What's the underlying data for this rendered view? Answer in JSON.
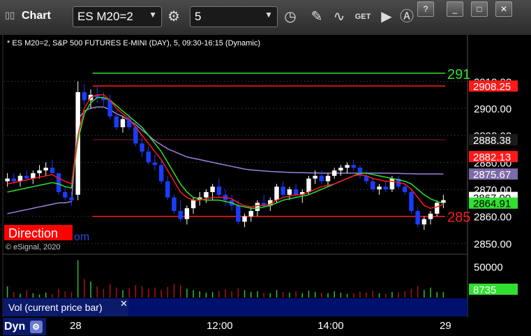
{
  "window": {
    "title": "Chart",
    "symbol_value": "ES M20=2",
    "interval_value": "5",
    "buttons": [
      "?",
      "_",
      "□",
      "✕"
    ]
  },
  "colors": {
    "background": "#000000",
    "up_candle": "#ffffff",
    "down_candle": "#1a3cff",
    "ema_fast": "#ff1a1a",
    "ema_slow": "#30e030",
    "vwap": "#a080e0",
    "level_red": "#ff1a1a",
    "level_green": "#30e030",
    "level_dark": "#5a0f2a",
    "volume_bar": "#b01010",
    "volume_bar_up": "#30c030"
  },
  "chart_data": {
    "type": "candlestick",
    "header": "* ES M20=2, S&P 500 FUTURES E-MINI (DAY), 5, 09:30-16:15 (Dynamic)",
    "watermark_direction": "Direction",
    "watermark_com": "om",
    "copyright": "© eSignal, 2020",
    "ylim": [
      2847,
      2922
    ],
    "y_ticks": [
      "2910.00",
      "2900.00",
      "2890.00",
      "2880.00",
      "2870.00",
      "2860.00",
      "2850.00"
    ],
    "y_tick_values": [
      2910,
      2900,
      2890,
      2880,
      2870,
      2860,
      2850
    ],
    "x_ticks": [
      "28",
      "12:00",
      "14:00",
      "29"
    ],
    "x_tick_positions": [
      0,
      37,
      67,
      100
    ],
    "levels": [
      {
        "value": 2913,
        "color": "#30e030",
        "label": "291",
        "start": 20
      },
      {
        "value": 2908.25,
        "color": "#ff1a1a",
        "label": "",
        "start": 20
      },
      {
        "value": 2888.38,
        "color": "#5a0f2a",
        "label": "",
        "start": 20
      },
      {
        "value": 2860,
        "color": "#ff1a1a",
        "label": "285",
        "start": 20
      }
    ],
    "price_flags": [
      {
        "value": 2908.25,
        "text": "2908.25",
        "bg": "#ff1a1a",
        "fg": "#ffffff"
      },
      {
        "value": 2888.38,
        "text": "2888.38",
        "bg": "#1a1a1a",
        "fg": "#ffffff"
      },
      {
        "value": 2882.13,
        "text": "2882.13",
        "bg": "#ff1a1a",
        "fg": "#ffffff"
      },
      {
        "value": 2875.67,
        "text": "2875.67",
        "bg": "#7d6aa8",
        "fg": "#ffffff"
      },
      {
        "value": 2867.0,
        "text": "2867.00",
        "bg": "#ffffff",
        "fg": "#000000"
      },
      {
        "value": 2864.91,
        "text": "2864.91",
        "bg": "#30e030",
        "fg": "#000000"
      }
    ],
    "candles": [
      [
        2873,
        2876,
        2871,
        2874
      ],
      [
        2874,
        2876,
        2872,
        2873
      ],
      [
        2873,
        2876,
        2871,
        2875
      ],
      [
        2875,
        2877,
        2873,
        2874
      ],
      [
        2874,
        2877,
        2872,
        2876
      ],
      [
        2876,
        2879,
        2874,
        2877
      ],
      [
        2877,
        2880,
        2875,
        2878
      ],
      [
        2878,
        2881,
        2876,
        2876
      ],
      [
        2876,
        2875,
        2868,
        2869
      ],
      [
        2869,
        2871,
        2866,
        2867
      ],
      [
        2867,
        2869,
        2864,
        2866
      ],
      [
        2868,
        2910,
        2866,
        2906
      ],
      [
        2906,
        2909,
        2901,
        2903
      ],
      [
        2903,
        2907,
        2900,
        2905
      ],
      [
        2905,
        2908,
        2902,
        2904
      ],
      [
        2904,
        2906,
        2901,
        2903
      ],
      [
        2903,
        2905,
        2896,
        2897
      ],
      [
        2897,
        2899,
        2892,
        2893
      ],
      [
        2893,
        2897,
        2891,
        2896
      ],
      [
        2896,
        2898,
        2892,
        2893
      ],
      [
        2893,
        2895,
        2886,
        2887
      ],
      [
        2887,
        2889,
        2882,
        2884
      ],
      [
        2884,
        2886,
        2879,
        2880
      ],
      [
        2880,
        2883,
        2877,
        2879
      ],
      [
        2879,
        2881,
        2872,
        2873
      ],
      [
        2873,
        2875,
        2866,
        2867
      ],
      [
        2867,
        2868,
        2861,
        2862
      ],
      [
        2862,
        2866,
        2858,
        2859
      ],
      [
        2859,
        2864,
        2857,
        2863
      ],
      [
        2863,
        2867,
        2861,
        2866
      ],
      [
        2866,
        2869,
        2864,
        2867
      ],
      [
        2867,
        2870,
        2865,
        2869
      ],
      [
        2869,
        2872,
        2866,
        2871
      ],
      [
        2871,
        2874,
        2867,
        2868
      ],
      [
        2868,
        2870,
        2864,
        2866
      ],
      [
        2866,
        2868,
        2862,
        2864
      ],
      [
        2864,
        2866,
        2857,
        2858
      ],
      [
        2858,
        2861,
        2856,
        2860
      ],
      [
        2860,
        2863,
        2858,
        2862
      ],
      [
        2862,
        2866,
        2860,
        2865
      ],
      [
        2865,
        2868,
        2863,
        2864
      ],
      [
        2864,
        2867,
        2862,
        2866
      ],
      [
        2866,
        2872,
        2865,
        2871
      ],
      [
        2871,
        2873,
        2867,
        2868
      ],
      [
        2868,
        2871,
        2866,
        2870
      ],
      [
        2870,
        2872,
        2867,
        2868
      ],
      [
        2868,
        2870,
        2865,
        2869
      ],
      [
        2869,
        2875,
        2868,
        2874
      ],
      [
        2874,
        2877,
        2872,
        2875
      ],
      [
        2875,
        2877,
        2872,
        2873
      ],
      [
        2873,
        2876,
        2871,
        2875
      ],
      [
        2875,
        2878,
        2874,
        2877
      ],
      [
        2877,
        2879,
        2875,
        2878
      ],
      [
        2878,
        2880,
        2876,
        2879
      ],
      [
        2879,
        2881,
        2877,
        2878
      ],
      [
        2878,
        2879,
        2874,
        2875
      ],
      [
        2875,
        2877,
        2872,
        2873
      ],
      [
        2873,
        2874,
        2869,
        2870
      ],
      [
        2870,
        2872,
        2868,
        2871
      ],
      [
        2871,
        2873,
        2869,
        2870
      ],
      [
        2870,
        2875,
        2869,
        2874
      ],
      [
        2874,
        2875,
        2870,
        2871
      ],
      [
        2871,
        2872,
        2868,
        2869
      ],
      [
        2869,
        2870,
        2861,
        2862
      ],
      [
        2862,
        2863,
        2856,
        2857
      ],
      [
        2857,
        2860,
        2855,
        2859
      ],
      [
        2859,
        2862,
        2857,
        2861
      ],
      [
        2861,
        2866,
        2860,
        2865
      ],
      [
        2865,
        2868,
        2863,
        2866
      ]
    ],
    "ema_fast": [
      2872,
      2872.5,
      2873,
      2873.5,
      2874,
      2874.5,
      2875,
      2875.5,
      2874,
      2873,
      2872,
      2890,
      2900,
      2904,
      2905,
      2905,
      2903,
      2900,
      2898,
      2896,
      2893,
      2890,
      2887,
      2884,
      2881,
      2877,
      2873,
      2869,
      2867,
      2866,
      2866,
      2866.5,
      2867,
      2867,
      2867,
      2866.5,
      2865,
      2864,
      2863.5,
      2864,
      2864,
      2864.5,
      2866,
      2867,
      2867.5,
      2868,
      2868,
      2869,
      2870,
      2871,
      2871.5,
      2872,
      2873,
      2874,
      2875,
      2875.5,
      2875,
      2874,
      2873.5,
      2873,
      2873,
      2872.5,
      2872,
      2870,
      2867,
      2864,
      2863,
      2863.5,
      2864.5
    ],
    "ema_slow": [
      2869,
      2869.5,
      2870,
      2870.5,
      2871,
      2871.5,
      2872,
      2872.5,
      2872,
      2871,
      2870.5,
      2888,
      2898,
      2902,
      2904,
      2904,
      2903,
      2901,
      2899,
      2897,
      2895,
      2893,
      2890,
      2887,
      2884,
      2880,
      2876,
      2872,
      2869,
      2867,
      2866.5,
      2866,
      2866,
      2866,
      2865.5,
      2865,
      2864,
      2863.5,
      2863,
      2863,
      2863.5,
      2864,
      2865,
      2866,
      2866.5,
      2867,
      2867.5,
      2868,
      2869,
      2870,
      2871,
      2872,
      2873,
      2874,
      2875,
      2876,
      2876,
      2875.5,
      2875,
      2874.5,
      2874,
      2873.5,
      2873,
      2872,
      2870,
      2868,
      2866.5,
      2865.5,
      2864.9
    ],
    "vwap": [
      2861,
      2861.5,
      2862,
      2862.5,
      2863,
      2863.5,
      2864,
      2864.5,
      2865,
      2865,
      2865.5,
      2896,
      2899,
      2900,
      2900.5,
      2900.5,
      2899.5,
      2898,
      2897,
      2895.5,
      2894,
      2892,
      2890,
      2888,
      2886.5,
      2885,
      2884,
      2883,
      2882,
      2881.5,
      2881,
      2880.5,
      2880,
      2879.5,
      2879,
      2878.5,
      2878,
      2877.5,
      2877.2,
      2877,
      2876.8,
      2876.6,
      2876.5,
      2876.4,
      2876.3,
      2876.2,
      2876.2,
      2876.1,
      2876.1,
      2876,
      2876,
      2876,
      2876,
      2876,
      2876,
      2876,
      2876,
      2876,
      2876,
      2876,
      2875.9,
      2875.9,
      2875.8,
      2875.8,
      2875.7,
      2875.7,
      2875.7,
      2875.7,
      2875.67
    ],
    "volume": {
      "label": "Vol (current price bar)",
      "y_ticks": [
        "50000"
      ],
      "y_tick_values": [
        50000
      ],
      "ylim": [
        0,
        65000
      ],
      "last_value": "8735",
      "values": [
        18000,
        9000,
        6000,
        12000,
        7000,
        5000,
        8000,
        6000,
        14000,
        10000,
        9000,
        60000,
        30000,
        26000,
        18000,
        14000,
        22000,
        16000,
        12000,
        15000,
        20000,
        18000,
        14000,
        16000,
        12000,
        17000,
        22000,
        20000,
        14000,
        12000,
        10000,
        8000,
        9000,
        11000,
        13000,
        10000,
        15000,
        12000,
        9000,
        10000,
        8000,
        7000,
        12000,
        9000,
        8000,
        10000,
        7000,
        11000,
        9000,
        8000,
        7000,
        10000,
        8000,
        6000,
        7000,
        9000,
        8000,
        11000,
        7000,
        6000,
        9000,
        8000,
        10000,
        14000,
        18000,
        12000,
        16000,
        9000,
        8735
      ]
    }
  },
  "status": {
    "dyn_label": "Dyn"
  }
}
